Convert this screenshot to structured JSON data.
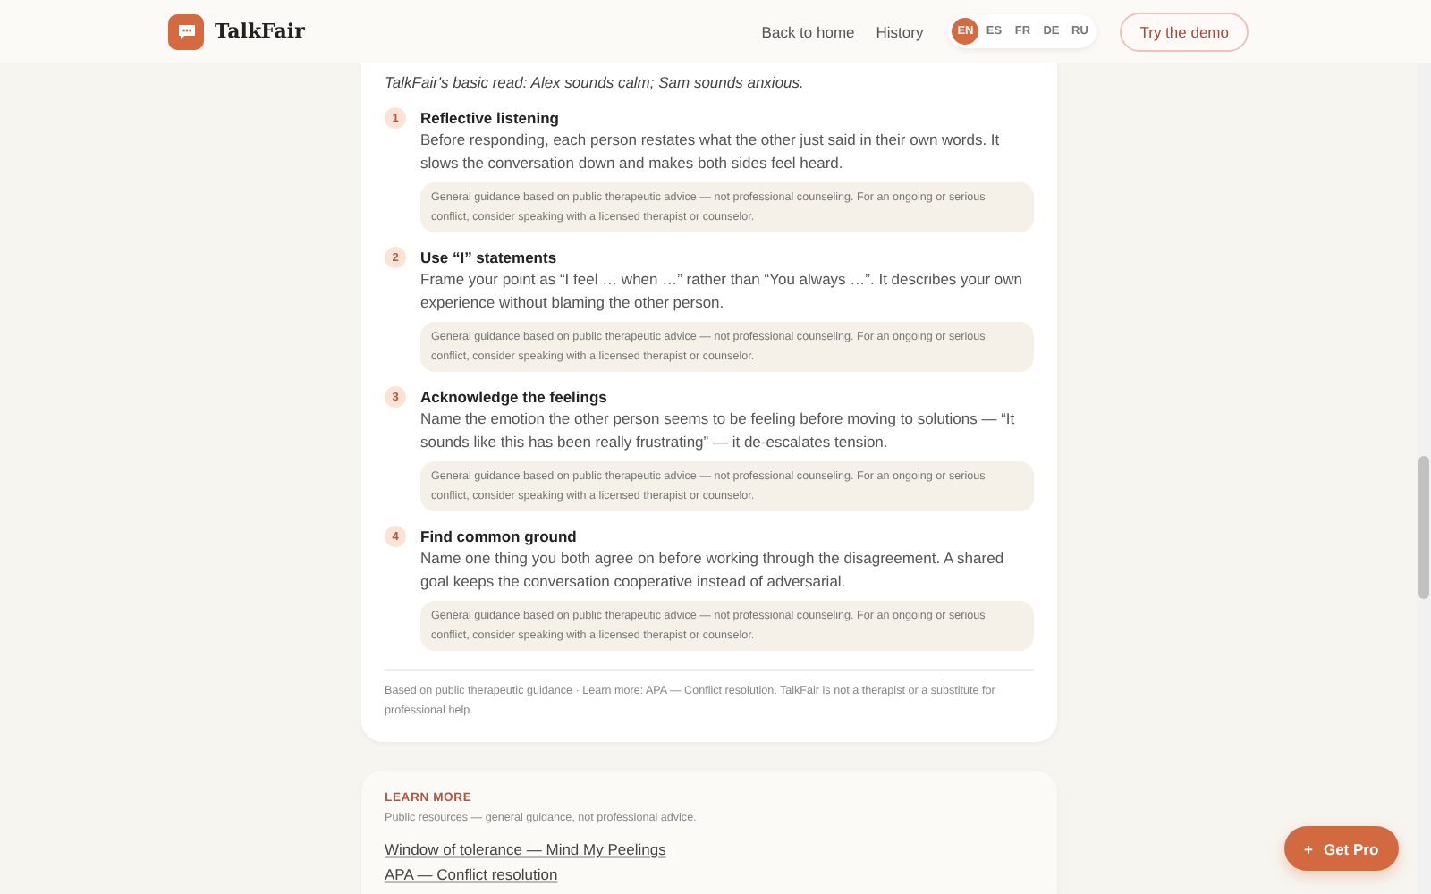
{
  "header": {
    "brand": "TalkFair",
    "nav": [
      "Back to home",
      "History"
    ],
    "languages": [
      {
        "label": "EN",
        "selected": true
      },
      {
        "label": "ES",
        "selected": false
      },
      {
        "label": "FR",
        "selected": false
      },
      {
        "label": "DE",
        "selected": false
      },
      {
        "label": "RU",
        "selected": false
      }
    ],
    "cta": "Try the demo"
  },
  "suggestion": {
    "summary": "TalkFair's basic read: Alex sounds calm; Sam sounds anxious.",
    "steps": [
      {
        "number": "1",
        "title": "Reflective listening",
        "text": "Before responding, each person restates what the other just said in their own words. It slows the conversation down and makes both sides feel heard.",
        "note": "General guidance based on public therapeutic advice — not professional counseling. For an ongoing or serious conflict, consider speaking with a licensed therapist or counselor."
      },
      {
        "number": "2",
        "title": "Use “I” statements",
        "text": "Frame your point as “I feel … when …” rather than “You always …”. It describes your own experience without blaming the other person.",
        "note": "General guidance based on public therapeutic advice — not professional counseling. For an ongoing or serious conflict, consider speaking with a licensed therapist or counselor."
      },
      {
        "number": "3",
        "title": "Acknowledge the feelings",
        "text": "Name the emotion the other person seems to be feeling before moving to solutions — “It sounds like this has been really frustrating” — it de-escalates tension.",
        "note": "General guidance based on public therapeutic advice — not professional counseling. For an ongoing or serious conflict, consider speaking with a licensed therapist or counselor."
      },
      {
        "number": "4",
        "title": "Find common ground",
        "text": "Name one thing you both agree on before working through the disagreement. A shared goal keeps the conversation cooperative instead of adversarial.",
        "note": "General guidance based on public therapeutic advice — not professional counseling. For an ongoing or serious conflict, consider speaking with a licensed therapist or counselor."
      }
    ],
    "footer": "Based on public therapeutic guidance · Learn more: APA — Conflict resolution. TalkFair is not a therapist or a substitute for professional help."
  },
  "learn_more": {
    "heading": "LEARN MORE",
    "subtitle": "Public resources — general guidance, not professional advice.",
    "links": [
      "Window of tolerance — Mind My Peelings",
      "APA — Conflict resolution"
    ]
  },
  "get_pro": {
    "icon": "+",
    "label": "Get Pro"
  }
}
